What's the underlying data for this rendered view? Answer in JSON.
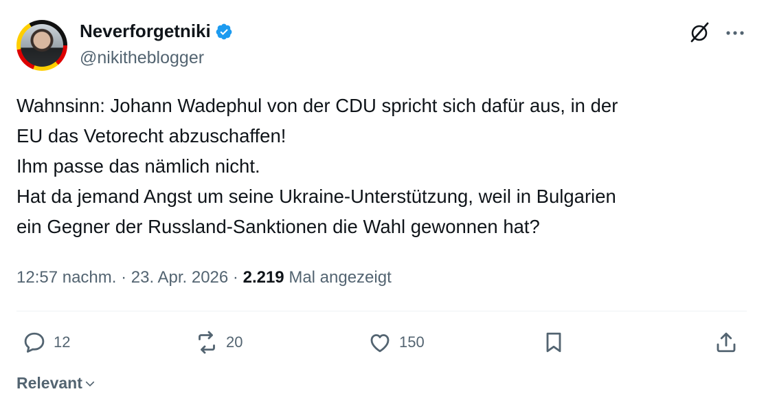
{
  "author": {
    "display_name": "Neverforgetniki",
    "handle": "@nikitheblogger",
    "verified": true
  },
  "tweet": {
    "lines": [
      "Wahnsinn: Johann Wadephul von der CDU spricht sich dafür aus, in der",
      "EU das Vetorecht abzuschaffen!",
      "Ihm passe das nämlich nicht.",
      "Hat da jemand Angst um seine Ukraine-Unterstützung, weil in Bulgarien",
      "ein Gegner der Russland-Sanktionen die Wahl gewonnen hat?"
    ],
    "time": "12:57 nachm.",
    "separator": "·",
    "date": "23. Apr. 2026",
    "views": "2.219",
    "views_label": "Mal angezeigt"
  },
  "actions": {
    "replies": "12",
    "reposts": "20",
    "likes": "150"
  },
  "sort": {
    "label": "Relevant"
  },
  "colors": {
    "verified_blue": "#1d9bf0",
    "secondary_text": "#536471",
    "primary_text": "#0f1419"
  }
}
